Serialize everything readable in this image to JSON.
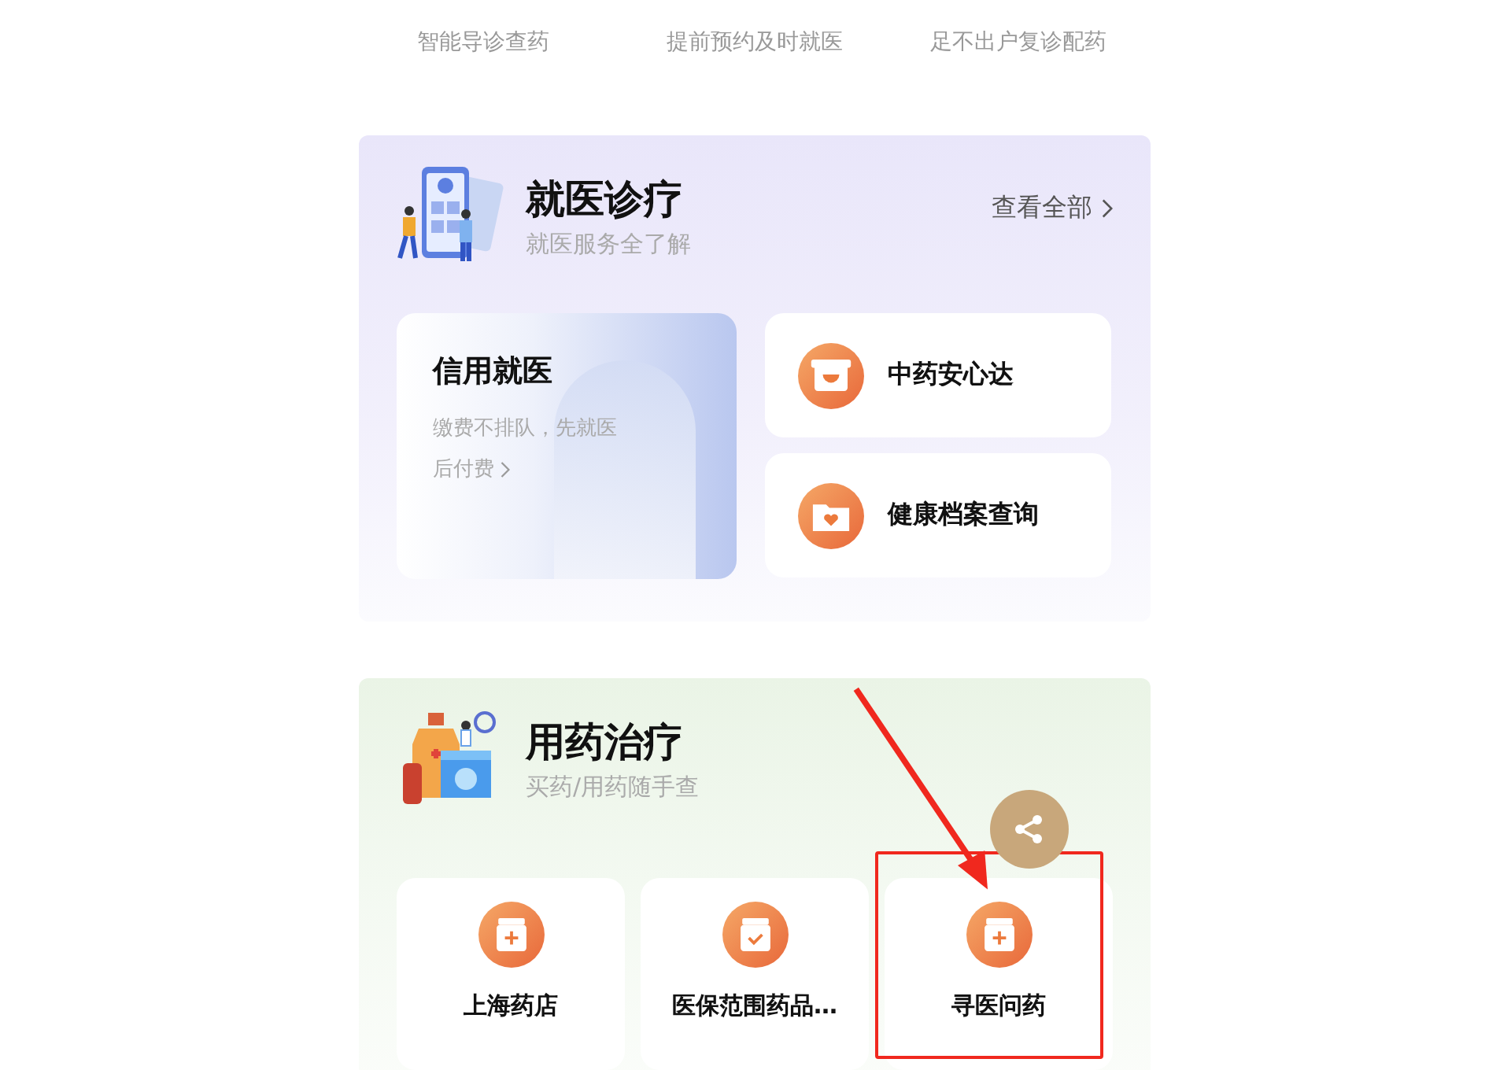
{
  "top_services": [
    {
      "subtitle": "智能导诊查药"
    },
    {
      "subtitle": "提前预约及时就医"
    },
    {
      "subtitle": "足不出户复诊配药"
    }
  ],
  "sections": [
    {
      "kind": "clinic",
      "title": "就医诊疗",
      "subtitle": "就医服务全了解",
      "more_link": "查看全部",
      "feature_card": {
        "title": "信用就医",
        "description": "缴费不排队，先就医",
        "link": "后付费"
      },
      "items": [
        {
          "label": "中药安心达",
          "kind": "box"
        },
        {
          "label": "健康档案查询",
          "kind": "folder"
        }
      ]
    },
    {
      "kind": "medicine",
      "title": "用药治疗",
      "subtitle": "买药/用药随手查",
      "items": [
        {
          "label": "上海药店",
          "kind": "plus",
          "highlighted": false
        },
        {
          "label": "医保范围药品…",
          "kind": "check",
          "highlighted": false
        },
        {
          "label": "寻医问药",
          "kind": "plus",
          "highlighted": true
        }
      ]
    }
  ]
}
